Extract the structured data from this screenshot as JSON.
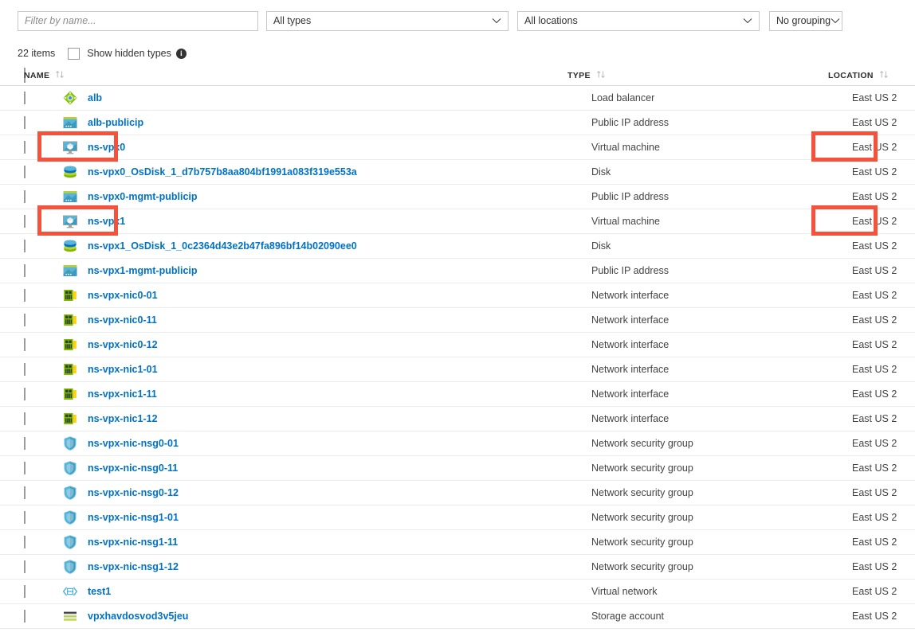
{
  "filter_bar": {
    "name_filter_value": "",
    "name_filter_placeholder": "Filter by name...",
    "types_value": "All types",
    "locations_value": "All locations",
    "grouping_value": "No grouping"
  },
  "count_bar": {
    "item_count": "22 items",
    "show_hidden_label": "Show hidden types",
    "info_glyph": "i",
    "show_hidden_checked": false
  },
  "table": {
    "headers": {
      "name": "NAME",
      "type": "TYPE",
      "location": "LOCATION"
    },
    "rows": [
      {
        "name": "alb",
        "type": "Load balancer",
        "location": "East US 2",
        "icon": "load-balancer-icon",
        "highlight_name": false,
        "highlight_location": false
      },
      {
        "name": "alb-publicip",
        "type": "Public IP address",
        "location": "East US 2",
        "icon": "public-ip-icon",
        "highlight_name": false,
        "highlight_location": false
      },
      {
        "name": "ns-vpx0",
        "type": "Virtual machine",
        "location": "East US 2",
        "icon": "virtual-machine-icon",
        "highlight_name": true,
        "highlight_location": true
      },
      {
        "name": "ns-vpx0_OsDisk_1_d7b757b8aa804bf1991a083f319e553a",
        "type": "Disk",
        "location": "East US 2",
        "icon": "disk-icon",
        "highlight_name": false,
        "highlight_location": false
      },
      {
        "name": "ns-vpx0-mgmt-publicip",
        "type": "Public IP address",
        "location": "East US 2",
        "icon": "public-ip-icon",
        "highlight_name": false,
        "highlight_location": false
      },
      {
        "name": "ns-vpx1",
        "type": "Virtual machine",
        "location": "East US 2",
        "icon": "virtual-machine-icon",
        "highlight_name": true,
        "highlight_location": true
      },
      {
        "name": "ns-vpx1_OsDisk_1_0c2364d43e2b47fa896bf14b02090ee0",
        "type": "Disk",
        "location": "East US 2",
        "icon": "disk-icon",
        "highlight_name": false,
        "highlight_location": false
      },
      {
        "name": "ns-vpx1-mgmt-publicip",
        "type": "Public IP address",
        "location": "East US 2",
        "icon": "public-ip-icon",
        "highlight_name": false,
        "highlight_location": false
      },
      {
        "name": "ns-vpx-nic0-01",
        "type": "Network interface",
        "location": "East US 2",
        "icon": "network-interface-icon",
        "highlight_name": false,
        "highlight_location": false
      },
      {
        "name": "ns-vpx-nic0-11",
        "type": "Network interface",
        "location": "East US 2",
        "icon": "network-interface-icon",
        "highlight_name": false,
        "highlight_location": false
      },
      {
        "name": "ns-vpx-nic0-12",
        "type": "Network interface",
        "location": "East US 2",
        "icon": "network-interface-icon",
        "highlight_name": false,
        "highlight_location": false
      },
      {
        "name": "ns-vpx-nic1-01",
        "type": "Network interface",
        "location": "East US 2",
        "icon": "network-interface-icon",
        "highlight_name": false,
        "highlight_location": false
      },
      {
        "name": "ns-vpx-nic1-11",
        "type": "Network interface",
        "location": "East US 2",
        "icon": "network-interface-icon",
        "highlight_name": false,
        "highlight_location": false
      },
      {
        "name": "ns-vpx-nic1-12",
        "type": "Network interface",
        "location": "East US 2",
        "icon": "network-interface-icon",
        "highlight_name": false,
        "highlight_location": false
      },
      {
        "name": "ns-vpx-nic-nsg0-01",
        "type": "Network security group",
        "location": "East US 2",
        "icon": "network-security-group-icon",
        "highlight_name": false,
        "highlight_location": false
      },
      {
        "name": "ns-vpx-nic-nsg0-11",
        "type": "Network security group",
        "location": "East US 2",
        "icon": "network-security-group-icon",
        "highlight_name": false,
        "highlight_location": false
      },
      {
        "name": "ns-vpx-nic-nsg0-12",
        "type": "Network security group",
        "location": "East US 2",
        "icon": "network-security-group-icon",
        "highlight_name": false,
        "highlight_location": false
      },
      {
        "name": "ns-vpx-nic-nsg1-01",
        "type": "Network security group",
        "location": "East US 2",
        "icon": "network-security-group-icon",
        "highlight_name": false,
        "highlight_location": false
      },
      {
        "name": "ns-vpx-nic-nsg1-11",
        "type": "Network security group",
        "location": "East US 2",
        "icon": "network-security-group-icon",
        "highlight_name": false,
        "highlight_location": false
      },
      {
        "name": "ns-vpx-nic-nsg1-12",
        "type": "Network security group",
        "location": "East US 2",
        "icon": "network-security-group-icon",
        "highlight_name": false,
        "highlight_location": false
      },
      {
        "name": "test1",
        "type": "Virtual network",
        "location": "East US 2",
        "icon": "virtual-network-icon",
        "highlight_name": false,
        "highlight_location": false
      },
      {
        "name": "vpxhavdosvod3v5jeu",
        "type": "Storage account",
        "location": "East US 2",
        "icon": "storage-account-icon",
        "highlight_name": false,
        "highlight_location": false
      }
    ]
  },
  "colors": {
    "link": "#0072c6",
    "highlight": "#f4523b",
    "border": "#ebebeb"
  }
}
